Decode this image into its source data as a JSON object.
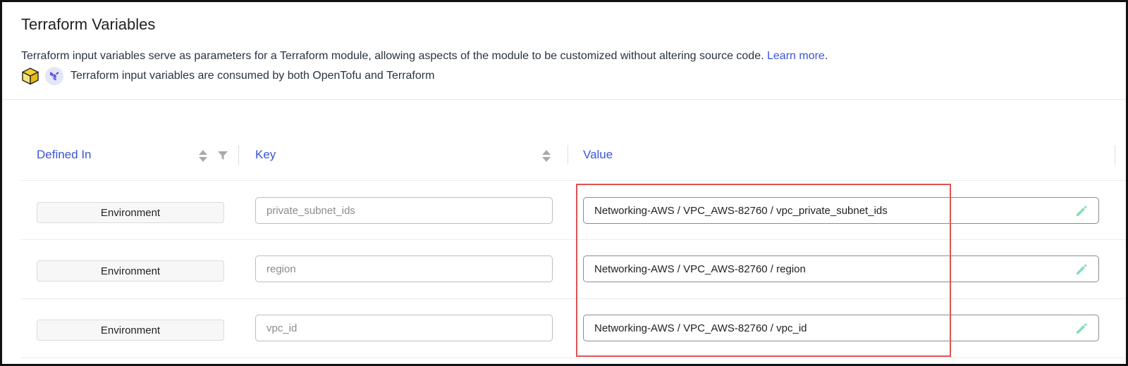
{
  "header": {
    "title": "Terraform Variables",
    "description": "Terraform input variables serve as parameters for a Terraform module, allowing aspects of the module to be customized without altering source code.",
    "learn_more": "Learn more",
    "period": ".",
    "consumed_note": "Terraform input variables are consumed by both OpenTofu and Terraform",
    "icons": [
      "opentofu-cube-icon",
      "terraform-logo-icon"
    ]
  },
  "table": {
    "columns": [
      "Defined In",
      "Key",
      "Value"
    ],
    "rows": [
      {
        "defined_in": "Environment",
        "key": "private_subnet_ids",
        "value": "Networking-AWS / VPC_AWS-82760 / vpc_private_subnet_ids"
      },
      {
        "defined_in": "Environment",
        "key": "region",
        "value": "Networking-AWS / VPC_AWS-82760 / region"
      },
      {
        "defined_in": "Environment",
        "key": "vpc_id",
        "value": "Networking-AWS / VPC_AWS-82760 / vpc_id"
      }
    ]
  },
  "colors": {
    "accent": "#3a55d8",
    "highlight": "#e05252",
    "edit_icon": "#7fe0b4"
  }
}
